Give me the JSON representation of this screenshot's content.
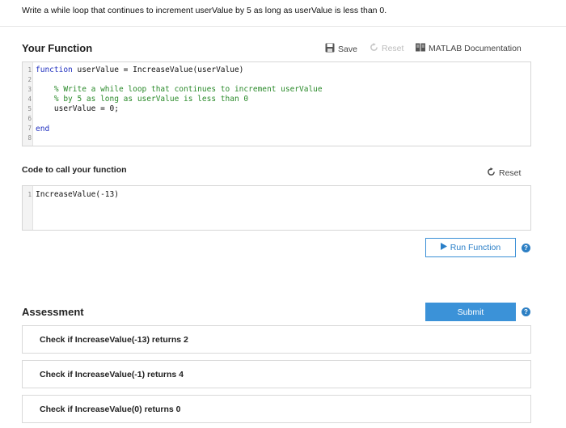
{
  "prompt": "Write a while loop that continues to increment userValue by 5 as long as userValue is less than 0.",
  "function_section": {
    "title": "Your Function",
    "toolbar": {
      "save_label": "Save",
      "reset_label": "Reset",
      "doc_label": "MATLAB Documentation"
    },
    "line_numbers": [
      "1",
      "2",
      "3",
      "4",
      "5",
      "6",
      "7",
      "8"
    ],
    "code": {
      "line1_kw": "function",
      "line1_rest": " userValue = IncreaseValue(userValue)",
      "line3": "    % Write a while loop that continues to increment userValue",
      "line4": "    % by 5 as long as userValue is less than 0",
      "line5": "    userValue = 0;",
      "line7_kw": "end"
    }
  },
  "call_section": {
    "title": "Code to call your function",
    "reset_label": "Reset",
    "line_numbers": [
      "1"
    ],
    "code_line1": "IncreaseValue(-13)",
    "run_label": "Run Function",
    "help_glyph": "?"
  },
  "assessment": {
    "title": "Assessment",
    "submit_label": "Submit",
    "help_glyph": "?",
    "checks": [
      "Check if IncreaseValue(-13) returns 2",
      "Check if IncreaseValue(-1) returns 4",
      "Check if IncreaseValue(0) returns 0"
    ]
  },
  "colors": {
    "accent": "#3b92d8",
    "keyword": "#1f2fbf",
    "comment": "#2a8a2a"
  }
}
